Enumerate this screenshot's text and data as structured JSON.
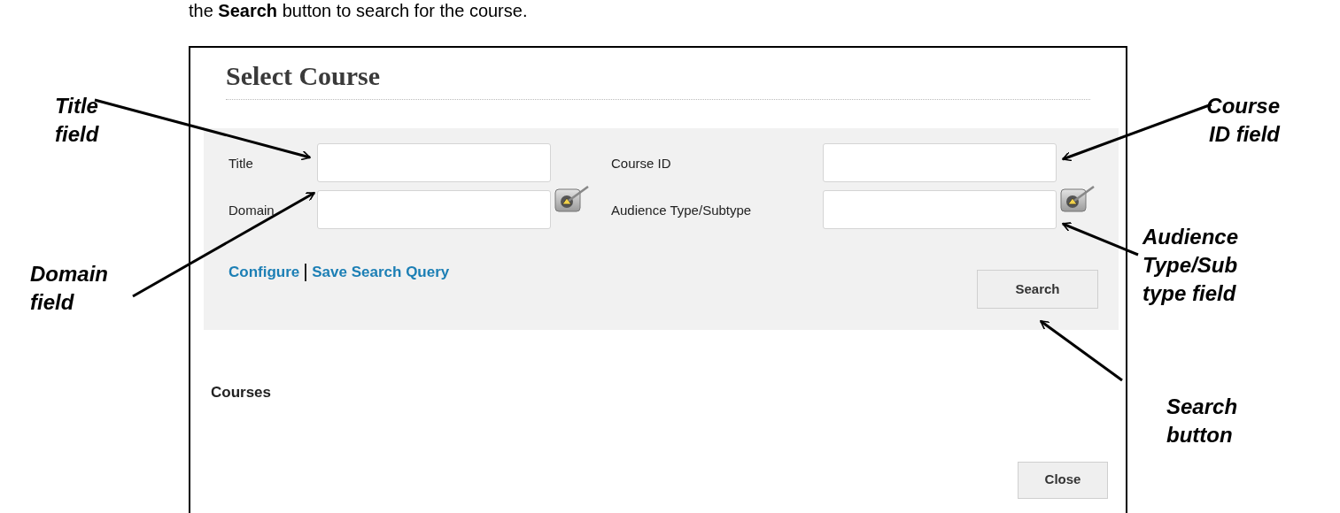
{
  "intro_text": "the **Search** button to search for the course.",
  "dialog": {
    "title": "Select Course",
    "fields": [
      {
        "label": "Title",
        "kind": "text"
      },
      {
        "label": "Course ID",
        "kind": "text"
      },
      {
        "label": "Domain",
        "kind": "picker"
      },
      {
        "label": "Audience Type/Subtype",
        "kind": "picker"
      }
    ],
    "links": [
      "Configure",
      "Save Search Query"
    ],
    "search_button": "Search",
    "section_title": "Courses",
    "close_button": "Close"
  },
  "callouts": [
    {
      "lines": [
        "Title",
        "field"
      ]
    },
    {
      "lines": [
        "Course",
        "ID field"
      ]
    },
    {
      "lines": [
        "Domain",
        "field"
      ]
    },
    {
      "lines": [
        "Audience",
        "Type/Sub",
        "type field"
      ]
    },
    {
      "lines": [
        "Search",
        "button"
      ]
    }
  ]
}
